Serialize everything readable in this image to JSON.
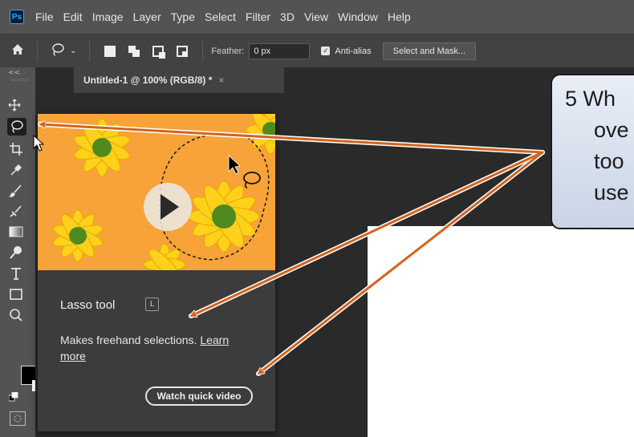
{
  "app": {
    "logo": "Ps"
  },
  "menu": [
    "File",
    "Edit",
    "Image",
    "Layer",
    "Type",
    "Select",
    "Filter",
    "3D",
    "View",
    "Window",
    "Help"
  ],
  "options": {
    "feather_label": "Feather:",
    "feather_value": "0 px",
    "antialias_label": "Anti-alias",
    "mask_button": "Select and Mask..."
  },
  "toolbar": {
    "collapse": "<<"
  },
  "document": {
    "tab_title": "Untitled-1 @ 100% (RGB/8) *",
    "close": "×"
  },
  "tooltip": {
    "title": "Lasso tool",
    "shortcut": "L",
    "desc": "Makes freehand selections.",
    "link": "Learn more",
    "button": "Watch quick video"
  },
  "callout": {
    "lines": [
      "5 Wh",
      "ove",
      "too",
      "use"
    ]
  },
  "colors": {
    "menubar": "#535353",
    "optionsbar": "#424242",
    "workspace": "#2a2a2a",
    "tooltip_bg": "#3c3c3c",
    "arrow": "#d2641e",
    "thumb_orange": "#f7a33a",
    "flower_yellow": "#ffd11a",
    "flower_center": "#4f8a1e"
  },
  "icons": [
    "ps-logo",
    "home-icon",
    "lasso-icon",
    "chevron-down-icon",
    "new-selection-icon",
    "add-selection-icon",
    "subtract-selection-icon",
    "intersect-selection-icon",
    "checkbox-icon",
    "move-icon",
    "marquee-icon",
    "crop-icon",
    "eyedropper-icon",
    "brush-icon",
    "clone-stamp-icon",
    "gradient-icon",
    "dodge-icon",
    "type-icon",
    "rectangle-icon",
    "zoom-icon",
    "swap-colors-icon",
    "quick-mask-icon",
    "play-icon",
    "cursor-icon"
  ]
}
